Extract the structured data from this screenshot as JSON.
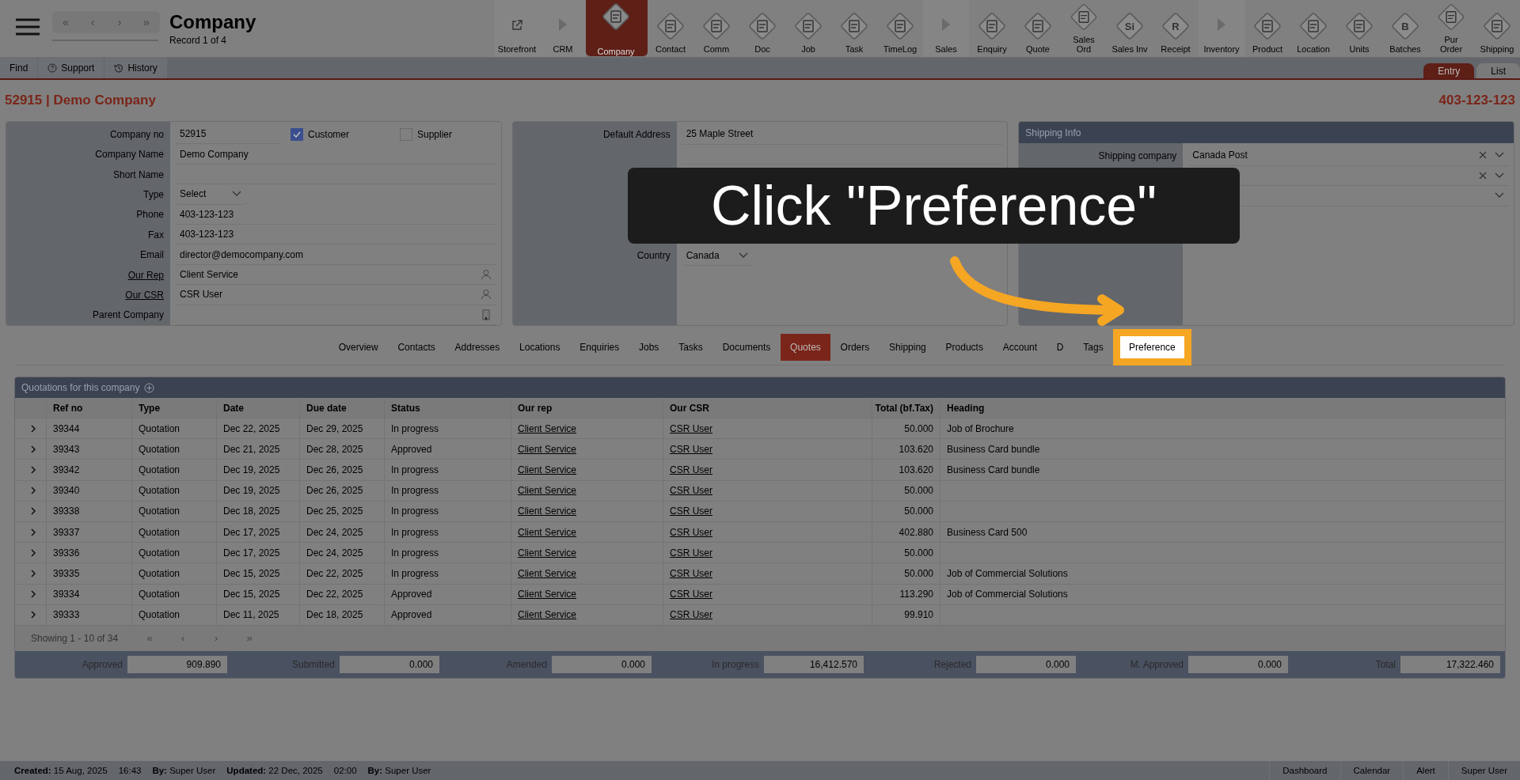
{
  "header": {
    "title": "Company",
    "subtitle": "Record 1 of 4",
    "pager": [
      "«",
      "‹",
      "›",
      "»"
    ]
  },
  "modules": [
    {
      "label": "Storefront",
      "kind": "link",
      "selected": false
    },
    {
      "label": "CRM",
      "kind": "section",
      "selected": false
    },
    {
      "label": "Company",
      "kind": "module",
      "selected": true
    },
    {
      "label": "Contact",
      "kind": "module",
      "selected": false
    },
    {
      "label": "Comm",
      "kind": "module",
      "selected": false
    },
    {
      "label": "Doc",
      "kind": "module",
      "selected": false
    },
    {
      "label": "Job",
      "kind": "module",
      "selected": false
    },
    {
      "label": "Task",
      "kind": "module",
      "selected": false
    },
    {
      "label": "TimeLog",
      "kind": "module",
      "selected": false
    },
    {
      "label": "Sales",
      "kind": "section",
      "selected": false
    },
    {
      "label": "Enquiry",
      "kind": "module",
      "selected": false
    },
    {
      "label": "Quote",
      "kind": "module",
      "selected": false
    },
    {
      "label": "Sales Ord",
      "kind": "module",
      "selected": false
    },
    {
      "label": "Sales Inv",
      "kind": "module",
      "glyph": "Si",
      "selected": false
    },
    {
      "label": "Receipt",
      "kind": "module",
      "glyph": "R",
      "selected": false
    },
    {
      "label": "Inventory",
      "kind": "section",
      "selected": false
    },
    {
      "label": "Product",
      "kind": "module",
      "selected": false
    },
    {
      "label": "Location",
      "kind": "module",
      "selected": false
    },
    {
      "label": "Units",
      "kind": "module",
      "selected": false
    },
    {
      "label": "Batches",
      "kind": "module",
      "glyph": "B",
      "selected": false
    },
    {
      "label": "Pur Order",
      "kind": "module",
      "selected": false
    },
    {
      "label": "Shipping",
      "kind": "module",
      "selected": false
    }
  ],
  "toolbar": [
    {
      "label": "Find",
      "kind": "plain"
    },
    {
      "label": "Support",
      "kind": "help"
    },
    {
      "label": "History",
      "kind": "history"
    }
  ],
  "view_tabs": [
    {
      "label": "Entry",
      "selected": true
    },
    {
      "label": "List",
      "selected": false
    }
  ],
  "record": {
    "title": "52915 | Demo Company",
    "phone": "403-123-123"
  },
  "company_panel": {
    "fields": [
      {
        "label": "Company no",
        "link": false,
        "kind": "flags",
        "value": "52915",
        "flags": [
          {
            "label": "Customer",
            "checked": true
          },
          {
            "label": "Supplier",
            "checked": false
          }
        ]
      },
      {
        "label": "Company Name",
        "link": false,
        "kind": "text",
        "value": "Demo Company"
      },
      {
        "label": "Short Name",
        "link": false,
        "kind": "text"
      },
      {
        "label": "Type",
        "link": false,
        "kind": "select",
        "value": "Select"
      },
      {
        "label": "Phone",
        "link": false,
        "kind": "text",
        "value": "403-123-123"
      },
      {
        "label": "Fax",
        "link": false,
        "kind": "text",
        "value": "403-123-123"
      },
      {
        "label": "Email",
        "link": false,
        "kind": "text",
        "value": "director@democompany.com"
      },
      {
        "label": "Our Rep",
        "link": true,
        "kind": "person",
        "value": "Client Service"
      },
      {
        "label": "Our CSR",
        "link": true,
        "kind": "person",
        "value": "CSR User"
      },
      {
        "label": "Parent Company",
        "link": false,
        "kind": "company"
      }
    ]
  },
  "address_panel": {
    "fields": [
      {
        "label": "Default Address",
        "kind": "text",
        "value": "25 Maple Street"
      },
      {
        "kind": "text"
      },
      {
        "kind": "blank"
      },
      {
        "kind": "blank"
      },
      {
        "kind": "blank"
      },
      {
        "kind": "blank"
      },
      {
        "label": "Country",
        "kind": "select",
        "value": "Canada"
      }
    ]
  },
  "shipping_panel": {
    "title": "Shipping Info",
    "fields": [
      {
        "label": "Shipping company",
        "kind": "clearable",
        "value": "Canada Post"
      },
      {
        "kind": "clearable"
      },
      {
        "kind": "wide_select"
      }
    ]
  },
  "tabs": [
    {
      "label": "Overview",
      "selected": false,
      "highlighted": false
    },
    {
      "label": "Contacts",
      "selected": false,
      "highlighted": false
    },
    {
      "label": "Addresses",
      "selected": false,
      "highlighted": false
    },
    {
      "label": "Locations",
      "selected": false,
      "highlighted": false
    },
    {
      "label": "Enquiries",
      "selected": false,
      "highlighted": false
    },
    {
      "label": "Jobs",
      "selected": false,
      "highlighted": false
    },
    {
      "label": "Tasks",
      "selected": false,
      "highlighted": false
    },
    {
      "label": "Documents",
      "selected": false,
      "highlighted": false
    },
    {
      "label": "Quotes",
      "selected": true,
      "highlighted": false
    },
    {
      "label": "Orders",
      "selected": false,
      "highlighted": false
    },
    {
      "label": "Shipping",
      "selected": false,
      "highlighted": false
    },
    {
      "label": "Products",
      "selected": false,
      "highlighted": false
    },
    {
      "label": "Account",
      "selected": false,
      "highlighted": false
    },
    {
      "label": "D",
      "selected": false,
      "highlighted": false
    },
    {
      "label": "Tags",
      "selected": false,
      "highlighted": false
    },
    {
      "label": "Preference",
      "selected": false,
      "highlighted": true
    }
  ],
  "quotes": {
    "title": "Quotations for this company",
    "columns": [
      "Ref no",
      "Type",
      "Date",
      "Due date",
      "Status",
      "Our rep",
      "Our CSR",
      "Total (bf.Tax)",
      "Heading"
    ],
    "rows": [
      {
        "ref": "39344",
        "type": "Quotation",
        "date": "Dec 22, 2025",
        "due": "Dec 29, 2025",
        "status": "In progress",
        "rep": "Client Service",
        "csr": "CSR User",
        "total": "50.000",
        "heading": "Job of Brochure"
      },
      {
        "ref": "39343",
        "type": "Quotation",
        "date": "Dec 21, 2025",
        "due": "Dec 28, 2025",
        "status": "Approved",
        "rep": "Client Service",
        "csr": "CSR User",
        "total": "103.620",
        "heading": "Business Card bundle"
      },
      {
        "ref": "39342",
        "type": "Quotation",
        "date": "Dec 19, 2025",
        "due": "Dec 26, 2025",
        "status": "In progress",
        "rep": "Client Service",
        "csr": "CSR User",
        "total": "103.620",
        "heading": "Business Card bundle"
      },
      {
        "ref": "39340",
        "type": "Quotation",
        "date": "Dec 19, 2025",
        "due": "Dec 26, 2025",
        "status": "In progress",
        "rep": "Client Service",
        "csr": "CSR User",
        "total": "50.000"
      },
      {
        "ref": "39338",
        "type": "Quotation",
        "date": "Dec 18, 2025",
        "due": "Dec 25, 2025",
        "status": "In progress",
        "rep": "Client Service",
        "csr": "CSR User",
        "total": "50.000"
      },
      {
        "ref": "39337",
        "type": "Quotation",
        "date": "Dec 17, 2025",
        "due": "Dec 24, 2025",
        "status": "In progress",
        "rep": "Client Service",
        "csr": "CSR User",
        "total": "402.880",
        "heading": "Business Card 500"
      },
      {
        "ref": "39336",
        "type": "Quotation",
        "date": "Dec 17, 2025",
        "due": "Dec 24, 2025",
        "status": "In progress",
        "rep": "Client Service",
        "csr": "CSR User",
        "total": "50.000"
      },
      {
        "ref": "39335",
        "type": "Quotation",
        "date": "Dec 15, 2025",
        "due": "Dec 22, 2025",
        "status": "In progress",
        "rep": "Client Service",
        "csr": "CSR User",
        "total": "50.000",
        "heading": "Job of Commercial Solutions"
      },
      {
        "ref": "39334",
        "type": "Quotation",
        "date": "Dec 15, 2025",
        "due": "Dec 22, 2025",
        "status": "Approved",
        "rep": "Client Service",
        "csr": "CSR User",
        "total": "113.290",
        "heading": "Job of Commercial Solutions"
      },
      {
        "ref": "39333",
        "type": "Quotation",
        "date": "Dec 11, 2025",
        "due": "Dec 18, 2025",
        "status": "Approved",
        "rep": "Client Service",
        "csr": "CSR User",
        "total": "99.910"
      }
    ],
    "pagination": {
      "text": "Showing 1 - 10 of 34",
      "buttons": [
        "«",
        "‹",
        "›",
        "»"
      ]
    },
    "totals": [
      {
        "label": "Approved",
        "value": "909.890"
      },
      {
        "label": "Submitted",
        "value": "0.000"
      },
      {
        "label": "Amended",
        "value": "0.000"
      },
      {
        "label": "In progress",
        "value": "16,412.570"
      },
      {
        "label": "Rejected",
        "value": "0.000"
      },
      {
        "label": "M. Approved",
        "value": "0.000"
      },
      {
        "label": "Total",
        "value": "17,322.460"
      }
    ]
  },
  "footer": {
    "info": [
      "**Created:** 15 Aug, 2025",
      "16:43",
      "**By:** Super User",
      "**Updated:** 22 Dec, 2025",
      "02:00",
      "**By:** Super User"
    ],
    "buttons": [
      "Dashboard",
      "Calendar",
      "Alert",
      "Super User"
    ]
  },
  "callout": {
    "text": "Click \"Preference\""
  }
}
